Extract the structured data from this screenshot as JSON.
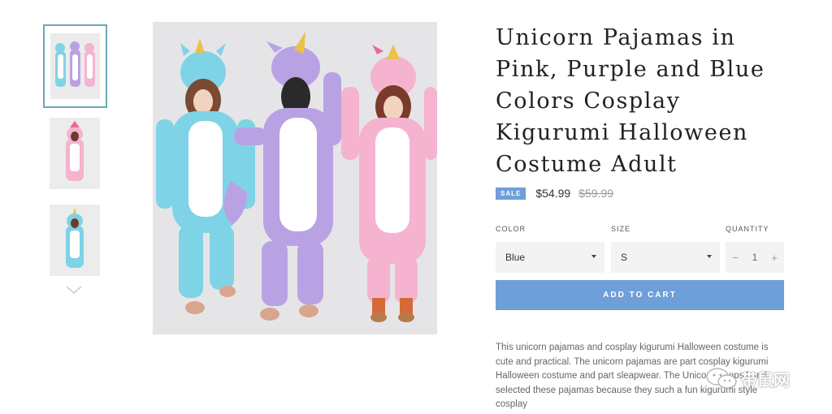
{
  "gallery": {
    "thumbnails": [
      {
        "alt": "three unicorn onesies",
        "active": true
      },
      {
        "alt": "pink unicorn onesie",
        "active": false
      },
      {
        "alt": "blue unicorn onesie",
        "active": false
      }
    ],
    "more_icon": "chevron-down-icon"
  },
  "product": {
    "title": "Unicorn Pajamas in Pink, Purple and Blue Colors Cosplay Kigurumi Halloween Costume Adult",
    "sale_badge": "SALE",
    "price": "$54.99",
    "compare_price": "$59.99",
    "options": {
      "color_label": "COLOR",
      "color_value": "Blue",
      "size_label": "SIZE",
      "size_value": "S",
      "quantity_label": "QUANTITY",
      "quantity_value": "1",
      "minus": "−",
      "plus": "+"
    },
    "add_to_cart": "ADD TO CART",
    "description": "This unicorn pajamas and cosplay kigurumi Halloween costume is cute and practical. The unicorn pajamas are part cosplay kigurumi Halloween costume and part sleapwear. The Unicorn Shops hand selected these pajamas because they such a fun kigurumi style cosplay"
  },
  "watermark": {
    "text": "带鼠网"
  },
  "colors": {
    "accent": "#6f9fd8",
    "thumb_border": "#6aa9b3",
    "blue_suit": "#7fd3e6",
    "purple_suit": "#b9a2e4",
    "pink_suit": "#f5b3cf"
  }
}
